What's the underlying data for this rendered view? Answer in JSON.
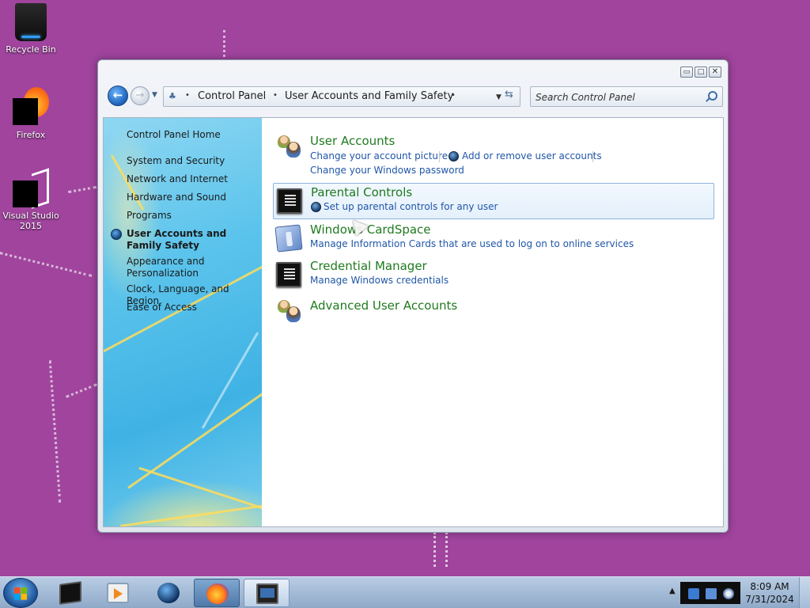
{
  "desktop": {
    "icons": [
      {
        "label": "Recycle Bin",
        "icon": "recycle-bin-icon"
      },
      {
        "label": "Firefox",
        "icon": "firefox-icon"
      },
      {
        "label": "Visual Studio 2015",
        "icon": "visual-studio-icon"
      }
    ]
  },
  "window": {
    "caption_buttons": {
      "minimize": "▭",
      "maximize": "□",
      "close": "✕"
    },
    "address": {
      "crumbs": [
        "Control Panel",
        "User Accounts and Family Safety"
      ],
      "search_placeholder": "Search Control Panel"
    },
    "nav": {
      "items": [
        {
          "label": "Control Panel Home",
          "current": false
        },
        {
          "label": "System and Security",
          "current": false
        },
        {
          "label": "Network and Internet",
          "current": false
        },
        {
          "label": "Hardware and Sound",
          "current": false
        },
        {
          "label": "Programs",
          "current": false
        },
        {
          "label": "User Accounts and Family Safety",
          "current": true
        },
        {
          "label": "Appearance and Personalization",
          "current": false
        },
        {
          "label": "Clock, Language, and Region",
          "current": false
        },
        {
          "label": "Ease of Access",
          "current": false
        }
      ]
    },
    "categories": [
      {
        "title": "User Accounts",
        "icon": "user-accounts-icon",
        "tasks": [
          "Change your account picture",
          "Add or remove user accounts",
          "Change your Windows password"
        ]
      },
      {
        "title": "Parental Controls",
        "icon": "parental-controls-icon",
        "tasks": [
          "Set up parental controls for any user"
        ]
      },
      {
        "title": "Windows CardSpace",
        "icon": "cardspace-icon",
        "tasks": [
          "Manage Information Cards that are used to log on to online services"
        ]
      },
      {
        "title": "Credential Manager",
        "icon": "credential-manager-icon",
        "tasks": [
          "Manage Windows credentials"
        ]
      },
      {
        "title": "Advanced User Accounts",
        "icon": "advanced-user-accounts-icon",
        "tasks": []
      }
    ]
  },
  "taskbar": {
    "clock": {
      "time": "8:09 AM",
      "date": "7/31/2024"
    }
  }
}
